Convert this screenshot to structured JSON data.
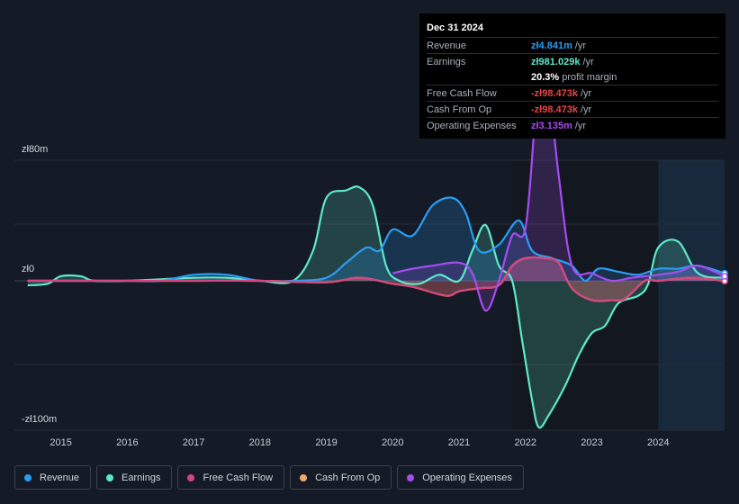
{
  "tooltip": {
    "date": "Dec 31 2024",
    "rows": [
      {
        "label": "Revenue",
        "value": "zł4.841m",
        "unit": "/yr",
        "color": "#2a9df4"
      },
      {
        "label": "Earnings",
        "value": "zł981.029k",
        "unit": "/yr",
        "color": "#5ee8c9"
      },
      {
        "label": "",
        "value": "20.3%",
        "unit": "profit margin",
        "color": "#ffffff"
      },
      {
        "label": "Free Cash Flow",
        "value": "-zł98.473k",
        "unit": "/yr",
        "color": "#e84545"
      },
      {
        "label": "Cash From Op",
        "value": "-zł98.473k",
        "unit": "/yr",
        "color": "#e84545"
      },
      {
        "label": "Operating Expenses",
        "value": "zł3.135m",
        "unit": "/yr",
        "color": "#a64cf0"
      }
    ]
  },
  "legend": [
    {
      "label": "Revenue",
      "color": "#2a9df4"
    },
    {
      "label": "Earnings",
      "color": "#5ee8c9"
    },
    {
      "label": "Free Cash Flow",
      "color": "#d6457f"
    },
    {
      "label": "Cash From Op",
      "color": "#f0a868"
    },
    {
      "label": "Operating Expenses",
      "color": "#a64cf0"
    }
  ],
  "chart_data": {
    "type": "area",
    "title": "",
    "xlabel": "",
    "ylabel": "",
    "y_tick_labels": [
      "zł80m",
      "zł0",
      "-zł100m"
    ],
    "ylim": [
      -100,
      80
    ],
    "xlim": [
      2014.3,
      2025.0
    ],
    "x_tick_labels": [
      "2015",
      "2016",
      "2017",
      "2018",
      "2019",
      "2020",
      "2021",
      "2022",
      "2023",
      "2024"
    ],
    "x_ticks": [
      2015,
      2016,
      2017,
      2018,
      2019,
      2020,
      2021,
      2022,
      2023,
      2024
    ],
    "forecast_start": 2024.0,
    "units": "zł millions",
    "series": [
      {
        "name": "Revenue",
        "color": "#2a9df4",
        "x": [
          2014.5,
          2015,
          2016,
          2016.5,
          2017,
          2017.5,
          2018,
          2018.5,
          2019,
          2019.3,
          2019.6,
          2019.8,
          2020,
          2020.3,
          2020.6,
          2020.9,
          2021.1,
          2021.3,
          2021.6,
          2021.9,
          2022.1,
          2022.4,
          2022.7,
          2022.9,
          2023.1,
          2023.4,
          2023.7,
          2024,
          2024.3,
          2024.6,
          2025
        ],
        "y": [
          0,
          0,
          0,
          0,
          4,
          4,
          0,
          0,
          2,
          12,
          22,
          20,
          34,
          30,
          50,
          55,
          45,
          20,
          24,
          40,
          20,
          15,
          10,
          0,
          8,
          6,
          4,
          8,
          8,
          10,
          5
        ]
      },
      {
        "name": "Earnings",
        "color": "#5ee8c9",
        "x": [
          2014.5,
          2014.8,
          2015,
          2015.3,
          2015.5,
          2016,
          2017,
          2017.5,
          2018,
          2018.5,
          2018.8,
          2019,
          2019.3,
          2019.5,
          2019.7,
          2019.9,
          2020.1,
          2020.4,
          2020.7,
          2021,
          2021.2,
          2021.4,
          2021.6,
          2021.8,
          2021.95,
          2022.1,
          2022.2,
          2022.35,
          2022.6,
          2022.8,
          2023,
          2023.2,
          2023.4,
          2023.7,
          2023.85,
          2024,
          2024.3,
          2024.6,
          2025
        ],
        "y": [
          -3,
          -2,
          3,
          3,
          0,
          0,
          2,
          2,
          0,
          0,
          20,
          55,
          60,
          62,
          50,
          10,
          0,
          -2,
          4,
          0,
          20,
          37,
          10,
          0,
          -40,
          -80,
          -98,
          -90,
          -70,
          -50,
          -35,
          -30,
          -15,
          -10,
          -2,
          22,
          26,
          5,
          2
        ]
      },
      {
        "name": "Free Cash Flow",
        "color": "#d6457f",
        "x": [
          2014.5,
          2015,
          2016,
          2017,
          2018,
          2019,
          2019.5,
          2020,
          2020.3,
          2020.8,
          2021,
          2021.3,
          2021.6,
          2021.8,
          2022,
          2022.3,
          2022.5,
          2022.7,
          2023,
          2023.3,
          2023.5,
          2023.8,
          2024,
          2024.5,
          2025
        ],
        "y": [
          0,
          0,
          0,
          0,
          0,
          -1,
          2,
          -2,
          -4,
          -10,
          -7,
          -5,
          -3,
          10,
          15,
          15,
          12,
          -5,
          -13,
          -13,
          -12,
          0,
          0,
          2,
          -0.1
        ]
      },
      {
        "name": "Cash From Op",
        "color": "#f0a868",
        "x": [
          2014.5,
          2015,
          2016,
          2017,
          2018,
          2019,
          2019.5,
          2020,
          2020.3,
          2020.8,
          2021,
          2021.3,
          2021.6,
          2021.8,
          2022,
          2022.3,
          2022.5,
          2022.7,
          2023,
          2023.3,
          2023.5,
          2023.8,
          2024,
          2024.5,
          2025
        ],
        "y": [
          0,
          0,
          0,
          0,
          0,
          -1,
          2,
          -2,
          -4,
          -10,
          -7,
          -5,
          -3,
          10,
          15,
          15,
          12,
          -5,
          -13,
          -13,
          -12,
          0,
          0,
          2,
          -0.1
        ]
      },
      {
        "name": "Operating Expenses",
        "color": "#a64cf0",
        "x": [
          2020,
          2020.3,
          2020.6,
          2021,
          2021.2,
          2021.4,
          2021.6,
          2021.8,
          2022,
          2022.15,
          2022.25,
          2022.35,
          2022.5,
          2022.7,
          2023,
          2023.3,
          2023.6,
          2024,
          2024.3,
          2024.6,
          2025
        ],
        "y": [
          5,
          8,
          10,
          12,
          5,
          -20,
          0,
          30,
          35,
          110,
          150,
          130,
          70,
          10,
          5,
          0,
          2,
          4,
          6,
          10,
          3
        ]
      }
    ]
  }
}
